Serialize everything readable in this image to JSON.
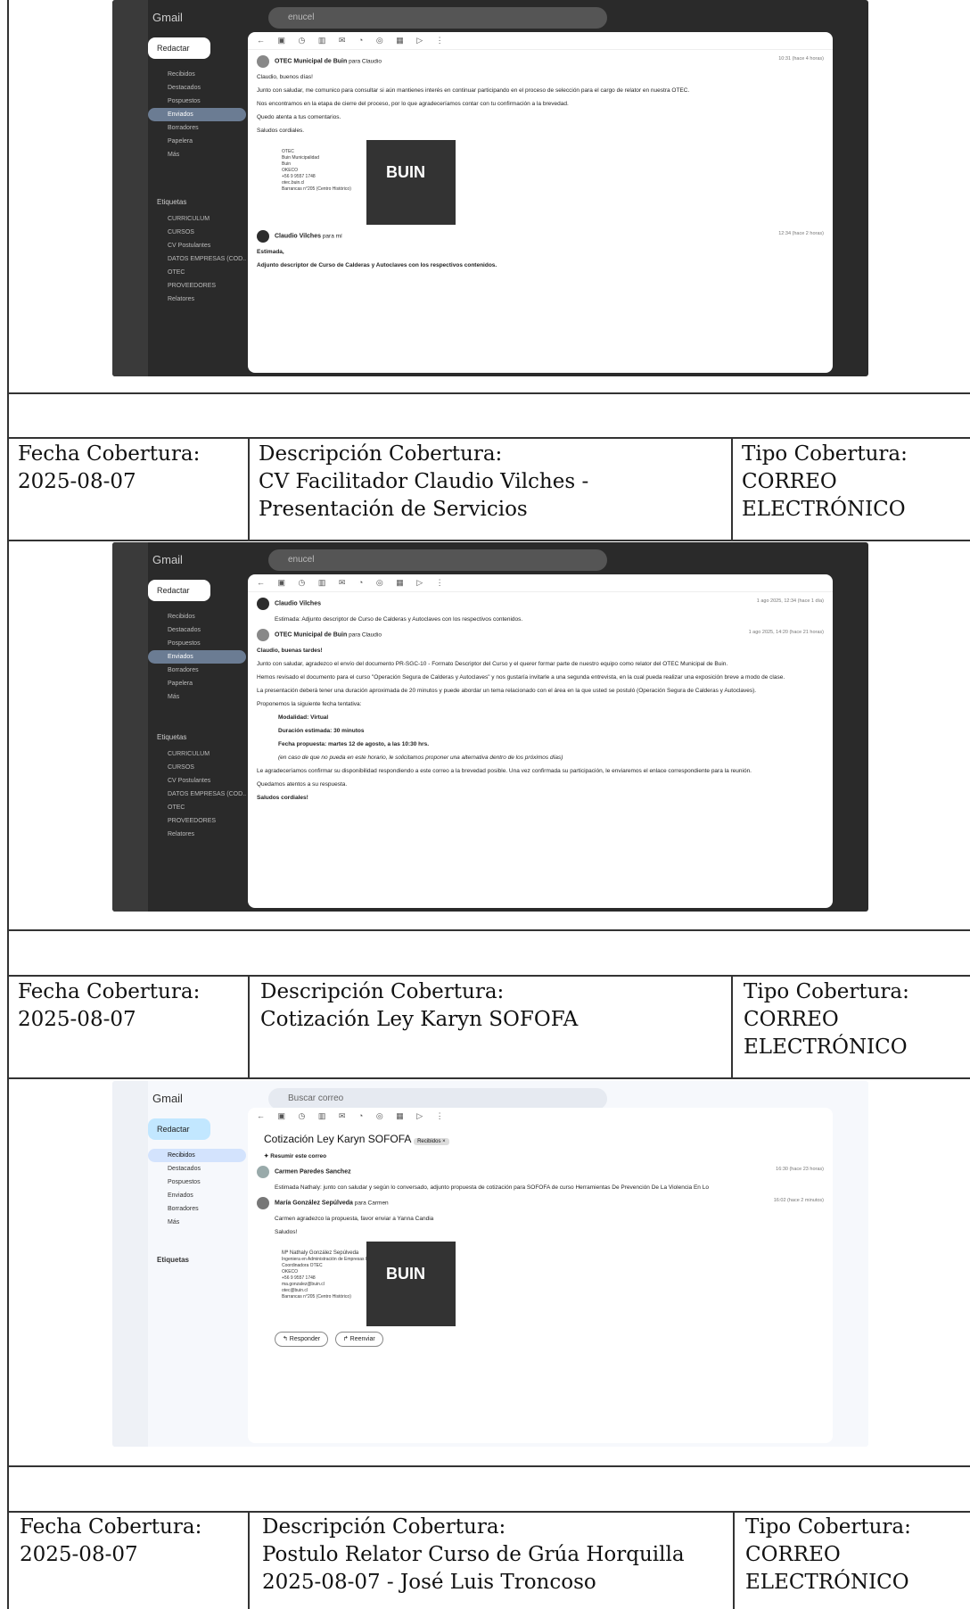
{
  "gmail": {
    "brand": "Gmail",
    "search_1": "enucel",
    "search_2": "enucel",
    "search_3": "Buscar correo",
    "compose": "Redactar",
    "nav": [
      "Recibidos",
      "Destacados",
      "Pospuestos",
      "Enviados",
      "Borradores",
      "Papelera",
      "Más"
    ],
    "nav3": [
      "Recibidos",
      "Destacados",
      "Pospuestos",
      "Enviados",
      "Borradores",
      "Más"
    ],
    "labels_header": "Etiquetas",
    "labels": [
      "CURRICULUM",
      "CURSOS",
      "CV Postulantes",
      "DATOS EMPRESAS (COD...",
      "OTEC",
      "PROVEEDORES",
      "Relatores"
    ],
    "toolbar_icons": "← ▣ ◷ ▥ ✉ ◔ ◎ ▦ ▷ ⋮",
    "shot1": {
      "sender": "OTEC Municipal de Buin",
      "to": "para Claudio",
      "time": "10:31 (hace 4 horas)",
      "greeting": "Claudio, buenos días!",
      "p1": "Junto con saludar, me comunico para consultar si aún mantienes interés en continuar participando en el proceso de selección para el cargo de relator en nuestra OTEC.",
      "p2": "Nos encontramos en la etapa de cierre del proceso, por lo que agradeceríamos contar con tu confirmación a la brevedad.",
      "p3": "Quedo atenta a tus comentarios.",
      "p4": "Saludos cordiales.",
      "sig_lines": [
        "OTEC",
        "Buin Municipalidad",
        "Buin",
        "OKECO",
        "+56 9 9557 1748",
        "otec.buin.cl",
        "Barrancas n°205 (Centro Histórico)"
      ],
      "sig_logo": "BUIN",
      "reply_sender": "Claudio Vilches",
      "reply_to": "para mí",
      "reply_time": "12:34 (hace 2 horas)",
      "reply_greeting": "Estimada,",
      "reply_text": "Adjunto descriptor de Curso de Calderas y Autoclaves con los respectivos contenidos."
    },
    "shot2": {
      "sender0": "Claudio Vilches",
      "sender0_text": "Estimada: Adjunto descriptor de Curso de Calderas y Autoclaves con los respectivos contenidos.",
      "sender0_time": "1 ago 2025, 12:34 (hace 1 día)",
      "sender": "OTEC Municipal de Buin",
      "to": "para Claudio",
      "time": "1 ago 2025, 14:20 (hace 21 horas)",
      "greeting": "Claudio, buenas tardes!",
      "p1": "Junto con saludar, agradezco el envío del documento PR-SGC-10 - Formato Descriptor del Curso y el querer formar parte de nuestro equipo como relator del OTEC Municipal de Buin.",
      "p2": "Hemos revisado el documento para el curso \"Operación Segura de Calderas y Autoclaves\" y nos gustaría invitarle a una segunda entrevista, en la cual pueda realizar una exposición breve a modo de clase.",
      "p3": "La presentación deberá tener una duración aproximada de 20 minutos y puede abordar un tema relacionado con el área en la que usted se postuló (Operación Segura de Calderas y Autoclaves).",
      "p4": "Proponemos la siguiente fecha tentativa:",
      "b1": "Modalidad: Virtual",
      "b2": "Duración estimada: 30 minutos",
      "b3": "Fecha propuesta: martes 12 de agosto, a las 10:30 hrs.",
      "b4": "(en caso de que no pueda en este horario, le solicitamos proponer una alternativa dentro de los próximos días)",
      "p5": "Le agradeceríamos confirmar su disponibilidad respondiendo a este correo a la brevedad posible. Una vez confirmada su participación, le enviaremos el enlace correspondiente para la reunión.",
      "p6": "Quedamos atentos a su respuesta.",
      "p7": "Saludos cordiales!"
    },
    "shot3": {
      "subject": "Cotización Ley Karyn SOFOFA",
      "tag": "Recibidos ×",
      "summary": "✦ Resumir este correo",
      "sender0": "Carmen Paredes Sanchez",
      "sender0_text": "Estimada Nathaly: junto con saludar y según lo conversado, adjunto propuesta de cotización para SOFOFA de curso Herramientas De Prevención De La Violencia En Lo",
      "sender0_time": "16:30 (hace 23 horas)",
      "sender": "María González Sepúlveda",
      "to": "para Carmen",
      "time": "16:02 (hace 2 minutos)",
      "p1": "Carmen agradezco la propuesta, favor enviar a Yanna Candia",
      "p2": "Saludos!",
      "sig_name": "Mª Nathaly González Sepúlveda",
      "sig_lines": [
        "Ingeniera en Administración de Empresas RRHH",
        "Coordinadora OTEC",
        "OKECO",
        "+56 9 9557 1748",
        "ma.gonzalez@buin.cl",
        "otec@buin.cl",
        "Barrancas n°205 (Centro Histórico)"
      ],
      "sig_logo": "BUIN",
      "reply": "↰ Responder",
      "forward": "↱ Reenviar"
    }
  },
  "rows": [
    {
      "fecha_label": "Fecha Cobertura:",
      "fecha": "2025-08-07",
      "desc_label": "Descripción Cobertura:",
      "desc": "CV Facilitador Claudio Vilches - Presentación de Servicios",
      "tipo_label": "Tipo Cobertura:",
      "tipo": "CORREO ELECTRÓNICO"
    },
    {
      "fecha_label": "Fecha Cobertura:",
      "fecha": "2025-08-07",
      "desc_label": "Descripción Cobertura:",
      "desc": "Cotización Ley Karyn SOFOFA",
      "tipo_label": "Tipo Cobertura:",
      "tipo": "CORREO ELECTRÓNICO"
    },
    {
      "fecha_label": "Fecha Cobertura:",
      "fecha": "2025-08-07",
      "desc_label": "Descripción Cobertura:",
      "desc": "Postulo Relator Curso de Grúa Horquilla 2025-08-07 - José Luis Troncoso",
      "tipo_label": "Tipo Cobertura:",
      "tipo": "CORREO ELECTRÓNICO"
    }
  ]
}
